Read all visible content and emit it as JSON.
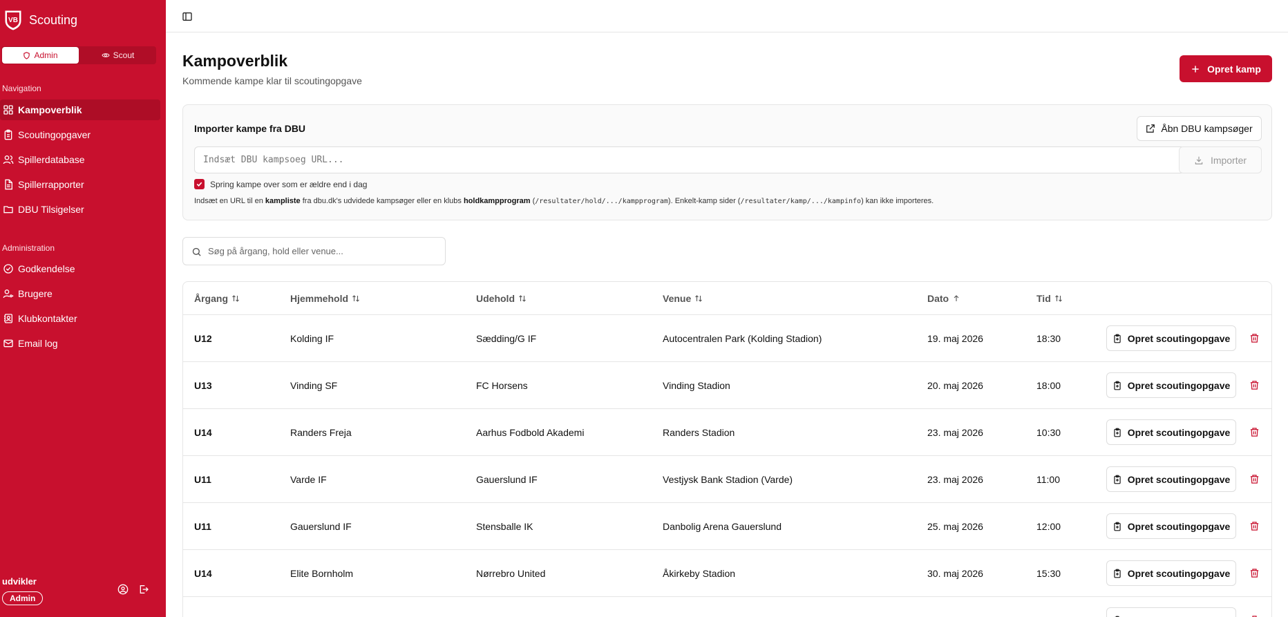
{
  "app": {
    "title": "Scouting",
    "logo_text": "VB"
  },
  "roles": {
    "admin": "Admin",
    "scout": "Scout",
    "active": "admin"
  },
  "nav": {
    "section_label": "Navigation",
    "items": [
      {
        "label": "Kampoverblik",
        "icon": "grid-icon",
        "active": true
      },
      {
        "label": "Scoutingopgaver",
        "icon": "clipboard-icon"
      },
      {
        "label": "Spillerdatabase",
        "icon": "users-icon"
      },
      {
        "label": "Spillerrapporter",
        "icon": "document-icon"
      },
      {
        "label": "DBU Tilsigelser",
        "icon": "folder-icon"
      }
    ]
  },
  "admin": {
    "section_label": "Administration",
    "items": [
      {
        "label": "Godkendelse",
        "icon": "check-circle-icon"
      },
      {
        "label": "Brugere",
        "icon": "user-key-icon"
      },
      {
        "label": "Klubkontakter",
        "icon": "contact-book-icon"
      },
      {
        "label": "Email log",
        "icon": "mail-icon"
      }
    ]
  },
  "user": {
    "name": "udvikler",
    "role": "Admin"
  },
  "header": {
    "title": "Kampoverblik",
    "subtitle": "Kommende kampe klar til scoutingopgave",
    "create_button": "Opret kamp"
  },
  "import": {
    "title": "Importer kampe fra DBU",
    "open_button": "Åbn DBU kampsøger",
    "url_placeholder": "Indsæt DBU kampsoeg URL...",
    "import_button": "Importer",
    "skip_label": "Spring kampe over som er ældre end i dag",
    "skip_checked": true,
    "help": {
      "t1": "Indsæt en URL til en ",
      "b1": "kampliste",
      "t2": " fra dbu.dk's udvidede kampsøger eller en klubs ",
      "b2": "holdkampprogram",
      "t3": " (",
      "c1": "/resultater/hold/.../kampprogram",
      "t4": "). Enkelt-kamp sider (",
      "c2": "/resultater/kamp/.../kampinfo",
      "t5": ") kan ikke importeres."
    }
  },
  "search": {
    "placeholder": "Søg på årgang, hold eller venue..."
  },
  "table": {
    "columns": [
      "Årgang",
      "Hjemmehold",
      "Udehold",
      "Venue",
      "Dato",
      "Tid"
    ],
    "action_label": "Opret scoutingopgave",
    "rows": [
      {
        "age": "U12",
        "home": "Kolding IF",
        "away": "Sædding/G IF",
        "venue": "Autocentralen Park (Kolding Stadion)",
        "date": "19. maj 2026",
        "time": "18:30"
      },
      {
        "age": "U13",
        "home": "Vinding SF",
        "away": "FC Horsens",
        "venue": "Vinding Stadion",
        "date": "20. maj 2026",
        "time": "18:00"
      },
      {
        "age": "U14",
        "home": "Randers Freja",
        "away": "Aarhus Fodbold Akademi",
        "venue": "Randers Stadion",
        "date": "23. maj 2026",
        "time": "10:30"
      },
      {
        "age": "U11",
        "home": "Varde IF",
        "away": "Gauerslund IF",
        "venue": "Vestjysk Bank Stadion (Varde)",
        "date": "23. maj 2026",
        "time": "11:00"
      },
      {
        "age": "U11",
        "home": "Gauerslund IF",
        "away": "Stensballe IK",
        "venue": "Danbolig Arena Gauerslund",
        "date": "25. maj 2026",
        "time": "12:00"
      },
      {
        "age": "U14",
        "home": "Elite Bornholm",
        "away": "Nørrebro United",
        "venue": "Åkirkeby Stadion",
        "date": "30. maj 2026",
        "time": "15:30"
      }
    ]
  },
  "colors": {
    "brand": "#c8102e",
    "sidebar_active": "#ad0d26",
    "border": "#e5e5e5"
  }
}
